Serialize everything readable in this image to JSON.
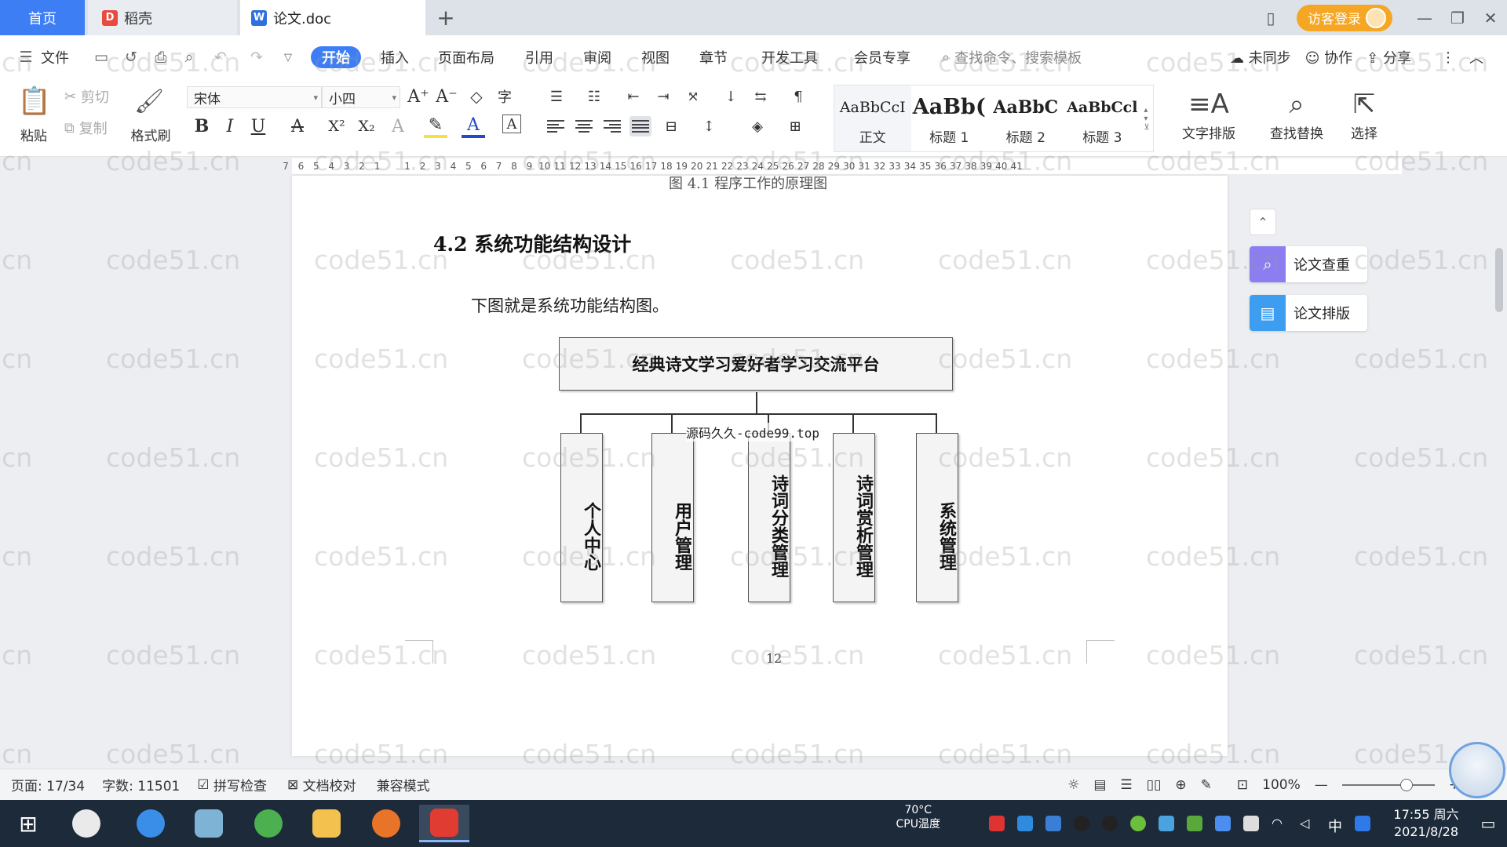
{
  "tabs": {
    "home": "首页",
    "daoke": "稻壳",
    "doc": "论文.doc",
    "add": "+"
  },
  "titlebar": {
    "visitor_login": "访客登录",
    "minimize": "—",
    "restore": "❐",
    "close": "✕"
  },
  "menu": {
    "file": "文件",
    "items": [
      "开始",
      "插入",
      "页面布局",
      "引用",
      "审阅",
      "视图",
      "章节",
      "开发工具",
      "会员专享"
    ],
    "search_placeholder": "查找命令、搜索模板",
    "right": [
      "未同步",
      "协作",
      "分享"
    ]
  },
  "ribbon": {
    "paste": "粘贴",
    "cut": "剪切",
    "copy": "复制",
    "format_painter": "格式刷",
    "font_name": "宋体",
    "font_size": "小四",
    "styles": [
      {
        "preview": "AaBbCcI",
        "name": "正文"
      },
      {
        "preview": "AaBb(",
        "name": "标题 1"
      },
      {
        "preview": "AaBbC",
        "name": "标题 2"
      },
      {
        "preview": "AaBbCcl",
        "name": "标题 3"
      }
    ],
    "text_layout": "文字排版",
    "find_replace": "查找替换",
    "select": "选择"
  },
  "ruler": {
    "ticks": [
      "7",
      "6",
      "5",
      "4",
      "3",
      "2",
      "1",
      "",
      "1",
      "2",
      "3",
      "4",
      "5",
      "6",
      "7",
      "8",
      "9",
      "10",
      "11",
      "12",
      "13",
      "14",
      "15",
      "16",
      "17",
      "18",
      "19",
      "20",
      "21",
      "22",
      "23",
      "24",
      "25",
      "26",
      "27",
      "28",
      "29",
      "30",
      "31",
      "32",
      "33",
      "34",
      "35",
      "36",
      "37",
      "38",
      "39",
      "40",
      "41"
    ]
  },
  "document": {
    "prev_caption": "图 4.1  程序工作的原理图",
    "section_heading": "4.2 系统功能结构设计",
    "intro": "下图就是系统功能结构图。",
    "org_chart": {
      "root": "经典诗文学习爱好者学习交流平台",
      "children": [
        "个人中心",
        "用户管理",
        "诗词分类管理",
        "诗词赏析管理",
        "系统管理"
      ]
    },
    "source_watermark": "源码久久-code99.top",
    "page_number": "12"
  },
  "side_panel": {
    "collapse": "⌃",
    "items": [
      "论文查重",
      "论文排版"
    ],
    "colors": [
      "#8c7ef0",
      "#3d9df0"
    ]
  },
  "watermark_text": "code51.cn",
  "status": {
    "page": "页面: 17/34",
    "words": "字数: 11501",
    "spellcheck": "拼写检查",
    "proofread": "文档校对",
    "compat": "兼容模式",
    "zoom": "100%",
    "zoom_level": 0.7
  },
  "taskbar": {
    "temperature": "70°C",
    "temp_label": "CPU温度",
    "ime": "中",
    "time": "17:55 周六",
    "date": "2021/8/28"
  },
  "colors": {
    "accent": "#3d7ef5",
    "visitor": "#f5a623",
    "taskbar": "#1c2a3a"
  }
}
